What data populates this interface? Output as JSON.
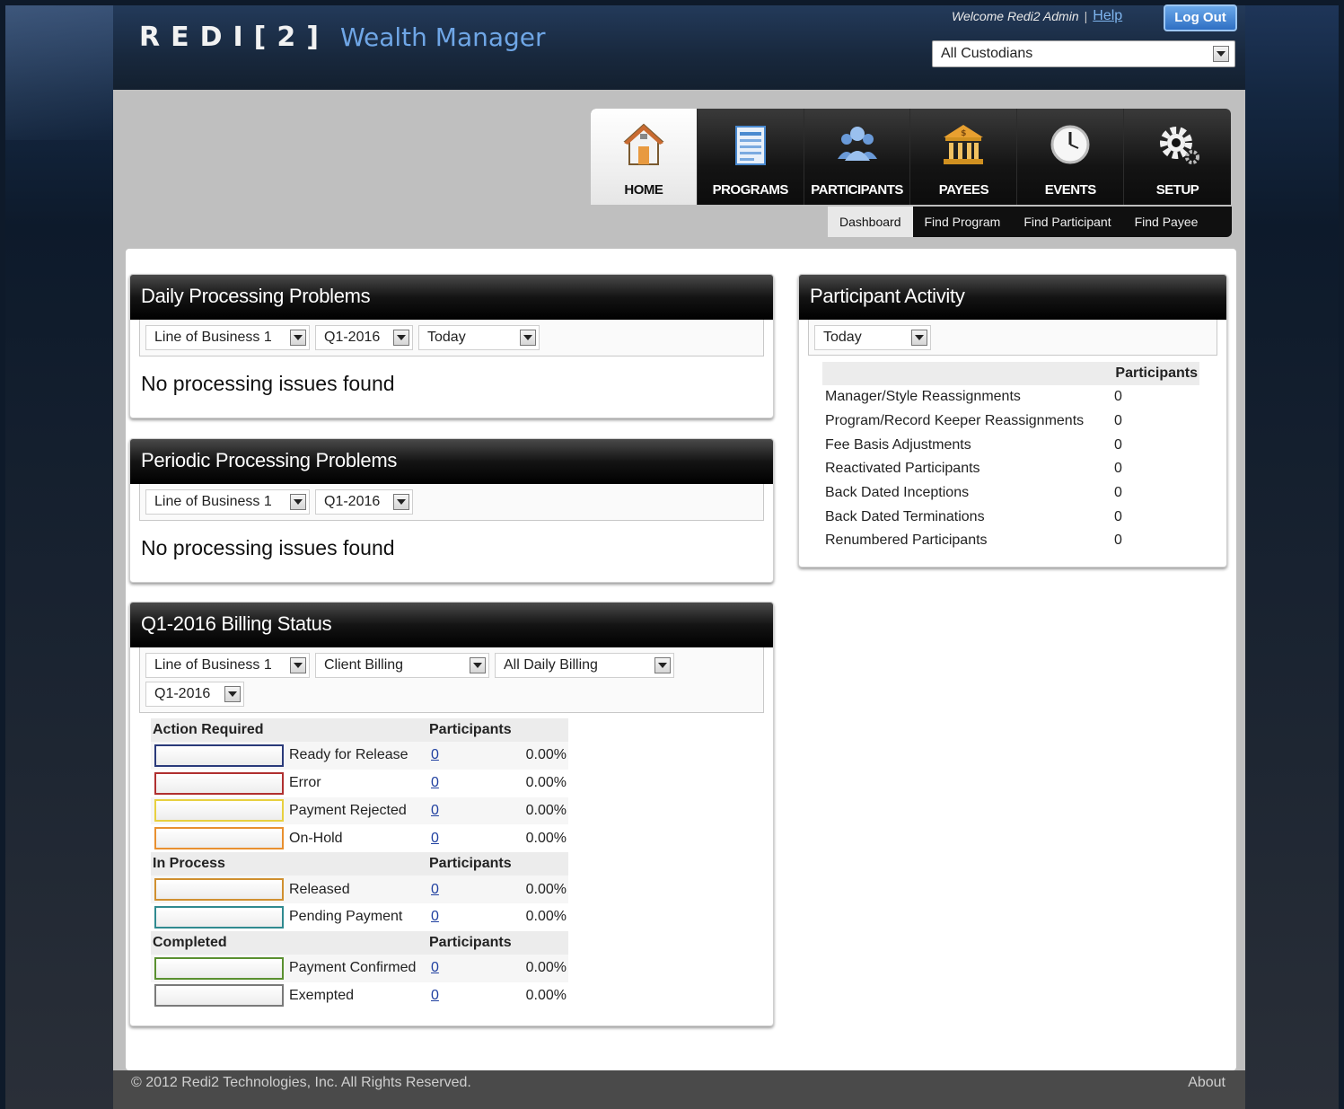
{
  "header": {
    "logo_brand": "REDI[2]",
    "logo_product": "Wealth Manager",
    "welcome": "Welcome Redi2 Admin",
    "help": "Help",
    "logout": "Log Out",
    "custodian": "All Custodians"
  },
  "nav": {
    "tabs": [
      {
        "label": "HOME",
        "icon": "home-icon"
      },
      {
        "label": "PROGRAMS",
        "icon": "document-icon"
      },
      {
        "label": "PARTICIPANTS",
        "icon": "people-icon"
      },
      {
        "label": "PAYEES",
        "icon": "bank-icon"
      },
      {
        "label": "EVENTS",
        "icon": "clock-icon"
      },
      {
        "label": "SETUP",
        "icon": "gear-icon"
      }
    ],
    "active": "HOME"
  },
  "subnav": {
    "items": [
      "Dashboard",
      "Find Program",
      "Find Participant",
      "Find Payee"
    ],
    "active": "Dashboard"
  },
  "daily": {
    "title": "Daily Processing Problems",
    "filters": [
      "Line of Business 1",
      "Q1-2016",
      "Today"
    ],
    "message": "No processing issues found"
  },
  "periodic": {
    "title": "Periodic Processing Problems",
    "filters": [
      "Line of Business 1",
      "Q1-2016"
    ],
    "message": "No processing issues found"
  },
  "billing": {
    "title": "Q1-2016 Billing Status",
    "filters": [
      "Line of Business 1",
      "Client Billing",
      "All Daily Billing",
      "Q1-2016"
    ],
    "sections": [
      {
        "heading": "Action Required",
        "col": "Participants",
        "rows": [
          {
            "label": "Ready for Release",
            "count": "0",
            "pct": "0.00%",
            "color": "#2a3a7a"
          },
          {
            "label": "Error",
            "count": "0",
            "pct": "0.00%",
            "color": "#b03030"
          },
          {
            "label": "Payment Rejected",
            "count": "0",
            "pct": "0.00%",
            "color": "#e8d040"
          },
          {
            "label": "On-Hold",
            "count": "0",
            "pct": "0.00%",
            "color": "#e89030"
          }
        ]
      },
      {
        "heading": "In Process",
        "col": "Participants",
        "rows": [
          {
            "label": "Released",
            "count": "0",
            "pct": "0.00%",
            "color": "#d09030"
          },
          {
            "label": "Pending Payment",
            "count": "0",
            "pct": "0.00%",
            "color": "#308a90"
          }
        ]
      },
      {
        "heading": "Completed",
        "col": "Participants",
        "rows": [
          {
            "label": "Payment Confirmed",
            "count": "0",
            "pct": "0.00%",
            "color": "#5a9030"
          },
          {
            "label": "Exempted",
            "count": "0",
            "pct": "0.00%",
            "color": "#7a7a7a"
          }
        ]
      }
    ]
  },
  "activity": {
    "title": "Participant Activity",
    "filter": "Today",
    "col": "Participants",
    "rows": [
      {
        "label": "Manager/Style Reassignments",
        "value": "0"
      },
      {
        "label": "Program/Record Keeper Reassignments",
        "value": "0"
      },
      {
        "label": "Fee Basis Adjustments",
        "value": "0"
      },
      {
        "label": "Reactivated Participants",
        "value": "0"
      },
      {
        "label": "Back Dated Inceptions",
        "value": "0"
      },
      {
        "label": "Back Dated Terminations",
        "value": "0"
      },
      {
        "label": "Renumbered Participants",
        "value": "0"
      }
    ]
  },
  "footer": {
    "copyright": "© 2012 Redi2 Technologies, Inc. All Rights Reserved.",
    "about": "About"
  }
}
